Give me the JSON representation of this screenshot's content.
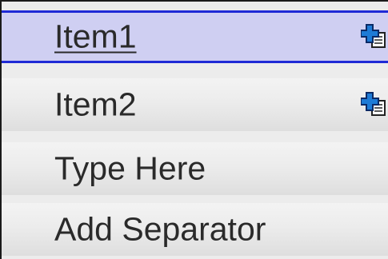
{
  "menu": {
    "items": [
      {
        "label": "Item1",
        "icon": "add-submenu-icon",
        "highlighted": true
      },
      {
        "label": "Item2",
        "icon": "add-submenu-icon",
        "highlighted": false
      },
      {
        "label": "Type Here",
        "icon": null,
        "highlighted": false
      },
      {
        "label": "Add Separator",
        "icon": null,
        "highlighted": false
      }
    ]
  },
  "colors": {
    "highlight_fill": "#cfcff2",
    "highlight_border": "#1f2ad6",
    "menu_background": "#ececec",
    "icon_blue": "#1e7bd6"
  }
}
